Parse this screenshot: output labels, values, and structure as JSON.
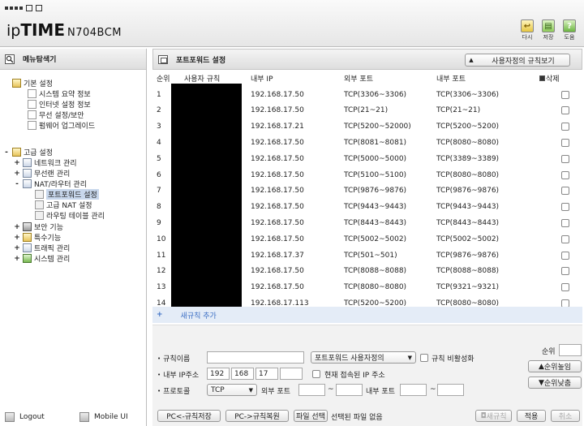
{
  "header": {
    "logo_ip": "ip",
    "logo_time": "TIME",
    "logo_model": "N704BCM",
    "buttons": [
      {
        "label": "다시",
        "icon": "back-icon"
      },
      {
        "label": "저장",
        "icon": "save-icon"
      },
      {
        "label": "도움",
        "icon": "help-icon"
      }
    ]
  },
  "sidebar": {
    "title": "메뉴탐색기",
    "groups": {
      "basic": {
        "label": "기본 설정",
        "items": [
          "시스템 요약 정보",
          "인터넷 설정 정보",
          "무선 설정/보안",
          "펌웨어 업그레이드"
        ]
      },
      "advanced": {
        "label": "고급 설정",
        "items": [
          "네트워크 관리",
          "무선랜 관리",
          "NAT/라우터 관리",
          "보안 기능",
          "특수기능",
          "트래픽 관리",
          "시스템 관리"
        ]
      },
      "nat": {
        "items": [
          "포트포워드 설정",
          "고급 NAT 설정",
          "라우팅 테이블 관리"
        ]
      }
    },
    "footer": {
      "logout": "Logout",
      "mobile": "Mobile UI"
    }
  },
  "main": {
    "title": "포트포워드 설정",
    "view_select": "사용자정의 규칙보기",
    "columns": {
      "no": "순위",
      "name": "사용자 규칙",
      "ip": "내부 IP",
      "ext": "외부 포트",
      "int": "내부 포트",
      "del": "삭제"
    },
    "rows": [
      {
        "no": "1",
        "ip": "192.168.17.50",
        "ext": "TCP(3306~3306)",
        "int": "TCP(3306~3306)"
      },
      {
        "no": "2",
        "ip": "192.168.17.50",
        "ext": "TCP(21~21)",
        "int": "TCP(21~21)"
      },
      {
        "no": "3",
        "ip": "192.168.17.21",
        "ext": "TCP(5200~52000)",
        "int": "TCP(5200~5200)"
      },
      {
        "no": "4",
        "ip": "192.168.17.50",
        "ext": "TCP(8081~8081)",
        "int": "TCP(8080~8080)"
      },
      {
        "no": "5",
        "ip": "192.168.17.50",
        "ext": "TCP(5000~5000)",
        "int": "TCP(3389~3389)"
      },
      {
        "no": "6",
        "ip": "192.168.17.50",
        "ext": "TCP(5100~5100)",
        "int": "TCP(8080~8080)"
      },
      {
        "no": "7",
        "ip": "192.168.17.50",
        "ext": "TCP(9876~9876)",
        "int": "TCP(9876~9876)"
      },
      {
        "no": "8",
        "ip": "192.168.17.50",
        "ext": "TCP(9443~9443)",
        "int": "TCP(9443~9443)"
      },
      {
        "no": "9",
        "ip": "192.168.17.50",
        "ext": "TCP(8443~8443)",
        "int": "TCP(8443~8443)"
      },
      {
        "no": "10",
        "ip": "192.168.17.50",
        "ext": "TCP(5002~5002)",
        "int": "TCP(5002~5002)"
      },
      {
        "no": "11",
        "ip": "192.168.17.37",
        "ext": "TCP(501~501)",
        "int": "TCP(9876~9876)"
      },
      {
        "no": "12",
        "ip": "192.168.17.50",
        "ext": "TCP(8088~8088)",
        "int": "TCP(8088~8088)"
      },
      {
        "no": "13",
        "ip": "192.168.17.50",
        "ext": "TCP(8080~8080)",
        "int": "TCP(9321~9321)"
      },
      {
        "no": "14",
        "ip": "192.168.17.113",
        "ext": "TCP(5200~5200)",
        "int": "TCP(8080~8080)"
      }
    ],
    "add_rule": "새규칙 추가",
    "add_plus": "+"
  },
  "form": {
    "rule_name_label": "규칙이름",
    "rule_type_select": "포트포워드 사용자정의",
    "disable_rule_label": "규칙 비활성화",
    "inner_ip_label": "내부 IP주소",
    "ip": [
      "192",
      "168",
      "17",
      ""
    ],
    "current_ip_label": "현재 접속된 IP 주소",
    "protocol_label": "프로토콜",
    "protocol_value": "TCP",
    "ext_port_label": "외부 포트",
    "int_port_label": "내부 포트",
    "tilde": "~",
    "priority_label": "순위",
    "priority_up": "순위높임",
    "priority_down": "순위낮춤",
    "save_pc": "PC<-규칙저장",
    "restore_pc": "PC->규칙복원",
    "file_select": "파일 선택",
    "no_file": "선택된 파일 없음",
    "new_rule": "새규칙",
    "apply": "적용",
    "cancel": "취소"
  }
}
